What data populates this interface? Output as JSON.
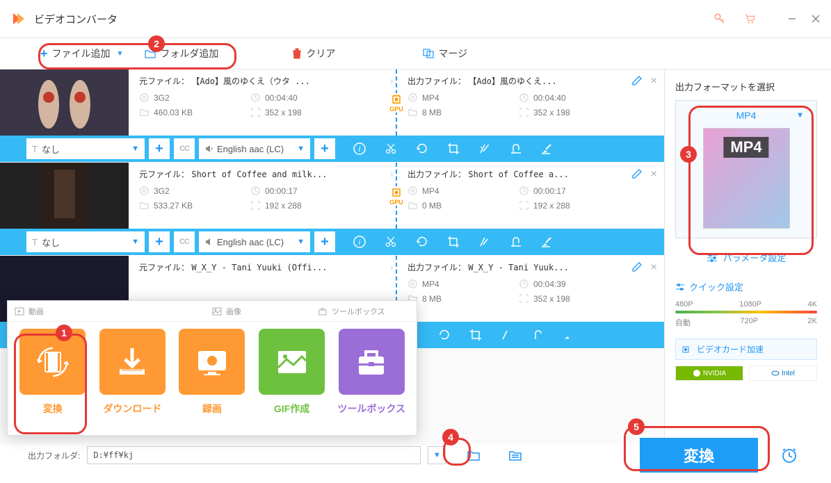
{
  "title": "ビデオコンバータ",
  "toolbar": {
    "add_file": "ファイル追加",
    "add_folder": "フォルダ追加",
    "clear": "クリア",
    "merge": "マージ"
  },
  "files": [
    {
      "src_label": "元ファイル：",
      "src_name": "【Ado】風のゆくえ（ウタ ...",
      "src_format": "3G2",
      "src_duration": "00:04:40",
      "src_size": "460.03 KB",
      "src_dims": "352 x 198",
      "out_label": "出力ファイル：",
      "out_name": "【Ado】風のゆくえ...",
      "out_format": "MP4",
      "out_duration": "00:04:40",
      "out_size": "8 MB",
      "out_dims": "352 x 198",
      "gpu": "GPU",
      "subtitle": "なし",
      "audio": "English aac (LC)"
    },
    {
      "src_label": "元ファイル：",
      "src_name": "Short of Coffee and milk...",
      "src_format": "3G2",
      "src_duration": "00:00:17",
      "src_size": "533.27 KB",
      "src_dims": "192 x 288",
      "out_label": "出力ファイル：",
      "out_name": "Short of Coffee a...",
      "out_format": "MP4",
      "out_duration": "00:00:17",
      "out_size": "0 MB",
      "out_dims": "192 x 288",
      "gpu": "GPU",
      "subtitle": "なし",
      "audio": "English aac (LC)"
    },
    {
      "src_label": "元ファイル：",
      "src_name": "W_X_Y - Tani Yuuki (Offi...",
      "out_label": "出力ファイル：",
      "out_name": "W_X_Y - Tani Yuuk...",
      "out_format": "MP4",
      "out_duration": "00:04:39",
      "out_size": "8 MB",
      "out_dims": "352 x 198"
    }
  ],
  "sidebar": {
    "title": "出力フォーマットを選択",
    "format": "MP4",
    "format_badge": "MP4",
    "param_settings": "パラメータ設定",
    "quick_settings": "クイック設定",
    "quality_top": [
      "480P",
      "1080P",
      "4K"
    ],
    "quality_bottom": [
      "自動",
      "720P",
      "2K"
    ],
    "gpu_accel": "ビデオカード加速",
    "nvidia": "NVIDIA",
    "intel": "Intel"
  },
  "bottom": {
    "output_folder_label": "出力フォルダ:",
    "output_folder_value": "D:¥ff¥kj",
    "convert": "変換"
  },
  "popup": {
    "tab_video": "動画",
    "tab_image": "画像",
    "tab_toolbox": "ツールボックス",
    "items": [
      {
        "label": "変換"
      },
      {
        "label": "ダウンロード"
      },
      {
        "label": "録画"
      },
      {
        "label": "GIF作成"
      },
      {
        "label": "ツールボックス"
      }
    ]
  },
  "callouts": [
    "1",
    "2",
    "3",
    "4",
    "5"
  ]
}
